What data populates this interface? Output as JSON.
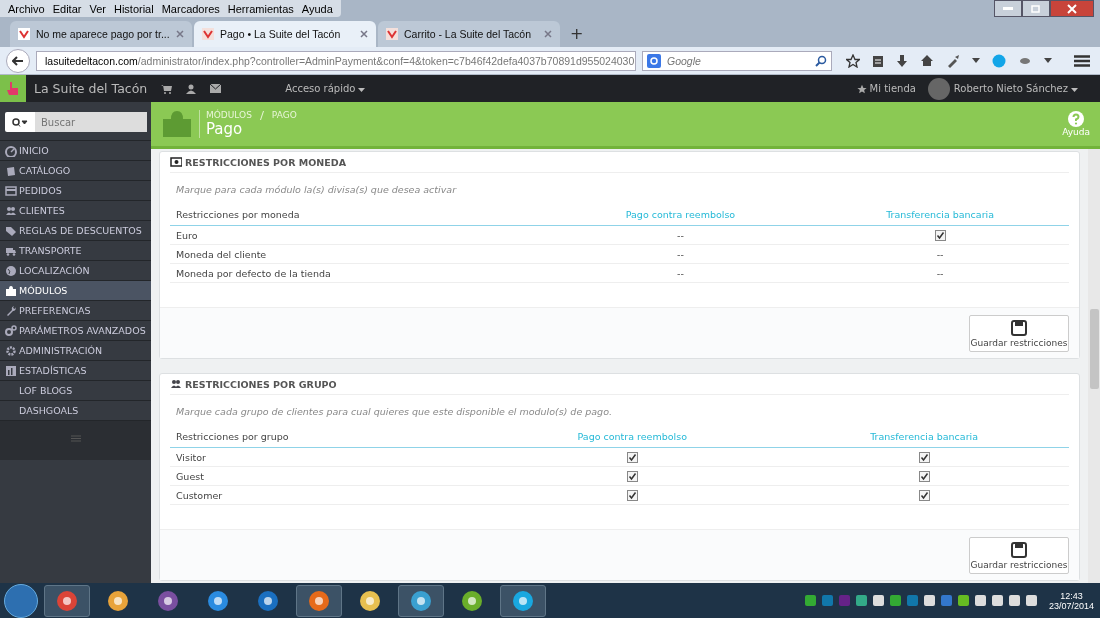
{
  "menu_bar": [
    "Archivo",
    "Editar",
    "Ver",
    "Historial",
    "Marcadores",
    "Herramientas",
    "Ayuda"
  ],
  "tabs": [
    {
      "label": "No me aparece pago por tr...",
      "selected": false
    },
    {
      "label": "Pago • La Suite del Tacón",
      "selected": true
    },
    {
      "label": "Carrito - La Suite del Tacón",
      "selected": false
    }
  ],
  "new_tab": "+",
  "address": {
    "domain": "lasuitedeltacon.com",
    "path": "/administrator/index.php?controller=AdminPayment&conf=4&token=c7b46f42defa4037b70891d955024030"
  },
  "search": {
    "placeholder": "Google"
  },
  "header": {
    "shop": "La Suite del Tacón",
    "quick_access": "Acceso rápido",
    "my_shop": "Mi tienda",
    "user": "Roberto Nieto Sánchez"
  },
  "sidebar": {
    "search_placeholder": "Buscar",
    "items": [
      {
        "label": "INICIO",
        "selected": false
      },
      {
        "label": "CATÁLOGO",
        "selected": false
      },
      {
        "label": "PEDIDOS",
        "selected": false
      },
      {
        "label": "CLIENTES",
        "selected": false
      },
      {
        "label": "REGLAS DE DESCUENTOS",
        "selected": false
      },
      {
        "label": "TRANSPORTE",
        "selected": false
      },
      {
        "label": "LOCALIZACIÓN",
        "selected": false
      },
      {
        "label": "MÓDULOS",
        "selected": true
      },
      {
        "label": "PREFERENCIAS",
        "selected": false
      },
      {
        "label": "PARÁMETROS AVANZADOS",
        "selected": false
      },
      {
        "label": "ADMINISTRACIÓN",
        "selected": false
      },
      {
        "label": "ESTADÍSTICAS",
        "selected": false
      },
      {
        "label": "LOF BLOGS",
        "selected": false
      },
      {
        "label": "DASHGOALS",
        "selected": false
      }
    ]
  },
  "page_header": {
    "breadcrumb": [
      "MÓDULOS",
      "PAGO"
    ],
    "title": "Pago",
    "help": "Ayuda"
  },
  "panels": [
    {
      "title": "RESTRICCIONES POR MONEDA",
      "hint": "Marque para cada módulo la(s) divisa(s) que desea activar",
      "columns": [
        "Restricciones por moneda",
        "Pago contra reembolso",
        "Transferencia bancaria"
      ],
      "rows": [
        {
          "cells": [
            {
              "kind": "text",
              "text": "Euro"
            },
            {
              "kind": "text",
              "text": "--"
            },
            {
              "kind": "checkbox",
              "checked": true
            }
          ]
        },
        {
          "cells": [
            {
              "kind": "text",
              "text": "Moneda del cliente"
            },
            {
              "kind": "text",
              "text": "--"
            },
            {
              "kind": "text",
              "text": "--"
            }
          ]
        },
        {
          "cells": [
            {
              "kind": "text",
              "text": "Moneda por defecto de la tienda"
            },
            {
              "kind": "text",
              "text": "--"
            },
            {
              "kind": "text",
              "text": "--"
            }
          ]
        }
      ],
      "button": "Guardar restricciones"
    },
    {
      "title": "RESTRICCIONES POR GRUPO",
      "hint": "Marque cada grupo de clientes para cual quieres que este disponible el modulo(s) de pago.",
      "columns": [
        "Restricciones por grupo",
        "Pago contra reembolso",
        "Transferencia bancaria"
      ],
      "rows": [
        {
          "cells": [
            {
              "kind": "text",
              "text": "Visitor"
            },
            {
              "kind": "checkbox",
              "checked": true
            },
            {
              "kind": "checkbox",
              "checked": true
            }
          ]
        },
        {
          "cells": [
            {
              "kind": "text",
              "text": "Guest"
            },
            {
              "kind": "checkbox",
              "checked": true
            },
            {
              "kind": "checkbox",
              "checked": true
            }
          ]
        },
        {
          "cells": [
            {
              "kind": "text",
              "text": "Customer"
            },
            {
              "kind": "checkbox",
              "checked": true
            },
            {
              "kind": "checkbox",
              "checked": true
            }
          ]
        }
      ],
      "button": "Guardar restricciones"
    }
  ],
  "clock": {
    "time": "12:43",
    "date": "23/07/2014"
  }
}
